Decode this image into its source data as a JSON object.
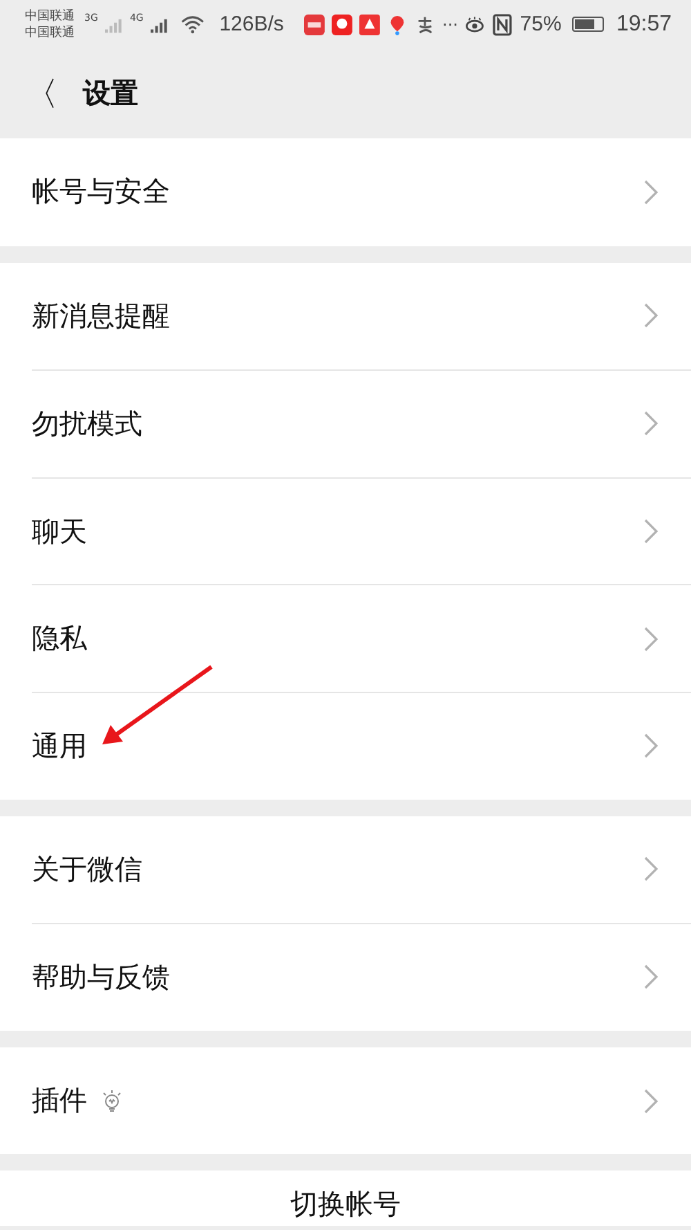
{
  "status_bar": {
    "carriers": [
      "中国联通",
      "中国联通"
    ],
    "network_types": [
      "3G",
      "4G"
    ],
    "speed": "126B/s",
    "overflow": "···",
    "battery_percent": "75%",
    "battery": {
      "level": 0.75
    },
    "time": "19:57"
  },
  "header": {
    "back": "〈",
    "title": "设置"
  },
  "sections": [
    {
      "items": [
        {
          "label": "帐号与安全",
          "kind": "plain"
        }
      ]
    },
    {
      "items": [
        {
          "label": "新消息提醒",
          "kind": "plain"
        },
        {
          "label": "勿扰模式",
          "kind": "plain"
        },
        {
          "label": "聊天",
          "kind": "plain"
        },
        {
          "label": "隐私",
          "kind": "plain"
        },
        {
          "label": "通用",
          "kind": "plain"
        }
      ]
    },
    {
      "items": [
        {
          "label": "关于微信",
          "kind": "plain"
        },
        {
          "label": "帮助与反馈",
          "kind": "plain"
        }
      ]
    },
    {
      "items": [
        {
          "label": "插件",
          "kind": "bulb"
        }
      ]
    }
  ],
  "switch_account": "切换帐号"
}
